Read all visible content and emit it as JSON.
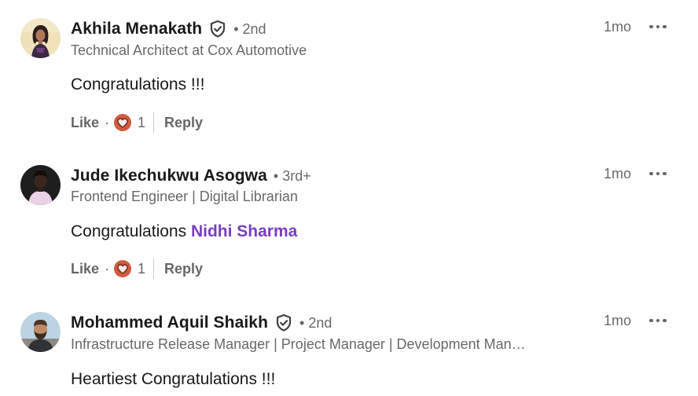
{
  "comments": [
    {
      "name": "Akhila Menakath",
      "verified": true,
      "degree": "• 2nd",
      "headline": "Technical Architect at Cox Automotive",
      "time": "1mo",
      "text": "Congratulations !!!",
      "mention": "",
      "like_label": "Like",
      "separator": "·",
      "reaction_count": "1",
      "reply_label": "Reply"
    },
    {
      "name": "Jude Ikechukwu Asogwa",
      "verified": false,
      "degree": "• 3rd+",
      "headline": "Frontend Engineer | Digital Librarian",
      "time": "1mo",
      "text": "Congratulations ",
      "mention": "Nidhi Sharma",
      "like_label": "Like",
      "separator": "·",
      "reaction_count": "1",
      "reply_label": "Reply"
    },
    {
      "name": "Mohammed Aquil Shaikh",
      "verified": true,
      "degree": "• 2nd",
      "headline": "Infrastructure Release Manager | Project Manager | Development Man…",
      "time": "1mo",
      "text": "Heartiest Congratulations !!!"
    }
  ],
  "icons": {
    "verified": "verified-shield-icon",
    "more": "more-options-icon",
    "reaction": "love-reaction-icon"
  },
  "colors": {
    "mention": "#7a3ec2",
    "reaction_bg": "#d15a3f",
    "text_secondary": "#666666"
  }
}
